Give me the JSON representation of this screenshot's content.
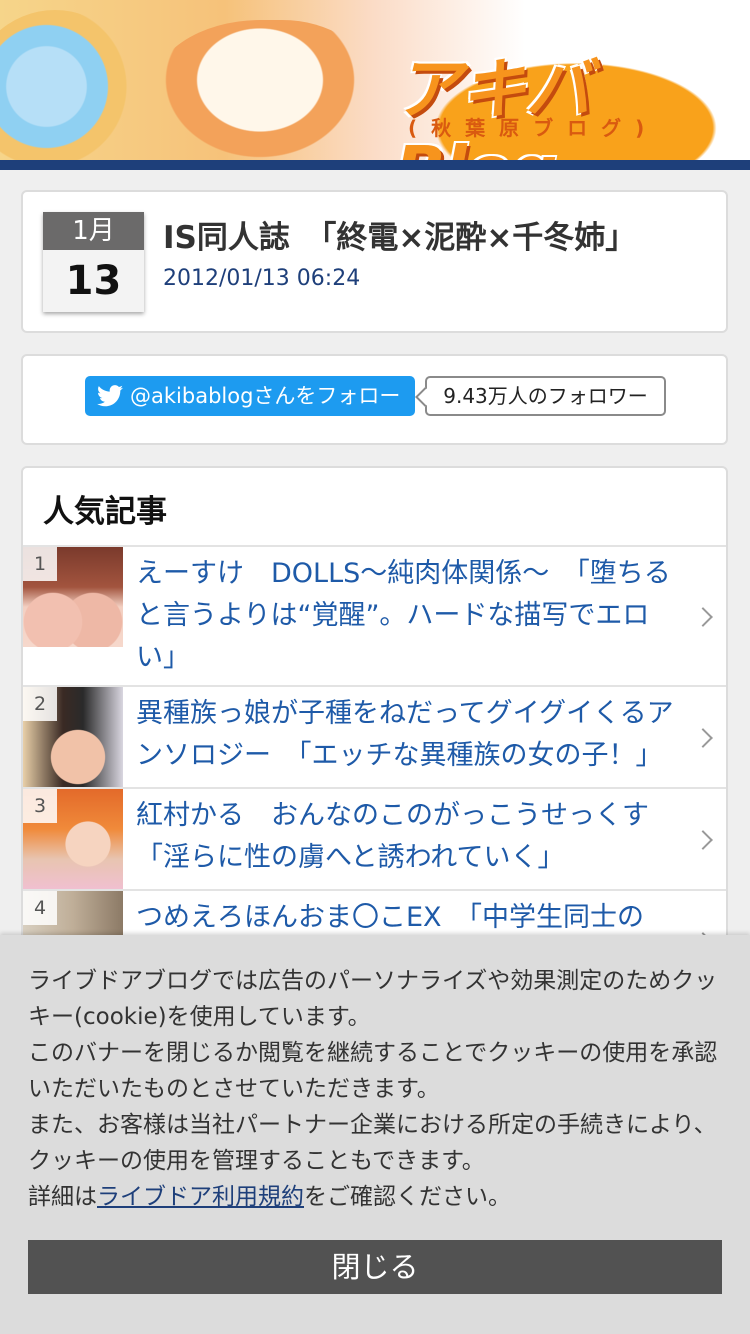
{
  "site": {
    "logo": "アキバBlog",
    "logo_sub": "(秋葉原ブログ)"
  },
  "article": {
    "month": "1月",
    "day": "13",
    "title": "IS同人誌　「終電×泥酔×千冬姉」",
    "datetime": "2012/01/13 06:24"
  },
  "twitter": {
    "follow_label": "@akibablogさんをフォロー",
    "followers": "9.43万人のフォロワー",
    "brand_color": "#1d9bf0"
  },
  "popular": {
    "heading": "人気記事",
    "items": [
      {
        "rank": "1",
        "title": "えーすけ　DOLLS～純肉体関係～　「堕ちると言うよりは“覚醒”。ハードな描写でエロい」"
      },
      {
        "rank": "2",
        "title": "異種族っ娘が子種をねだってグイグイくるアンソロジー　「エッチな異種族の女の子！」"
      },
      {
        "rank": "3",
        "title": "紅村かる　おんなのこのがっこうせっくす「淫らに性の虜へと誘われていく」"
      },
      {
        "rank": "4",
        "title": "つめえろほんおま〇こEX　「中学生同士の"
      }
    ]
  },
  "cookie": {
    "line1": "ライブドアブログでは広告のパーソナライズや効果測定のためクッキー(cookie)を使用しています。",
    "line2": "このバナーを閉じるか閲覧を継続することでクッキーの使用を承認いただいたものとさせていただきます。",
    "line3": "また、お客様は当社パートナー企業における所定の手続きにより、クッキーの使用を管理することもできます。",
    "detail_prefix": "詳細は",
    "detail_link": "ライブドア利用規約",
    "detail_suffix": "をご確認ください。",
    "close_label": "閉じる"
  }
}
